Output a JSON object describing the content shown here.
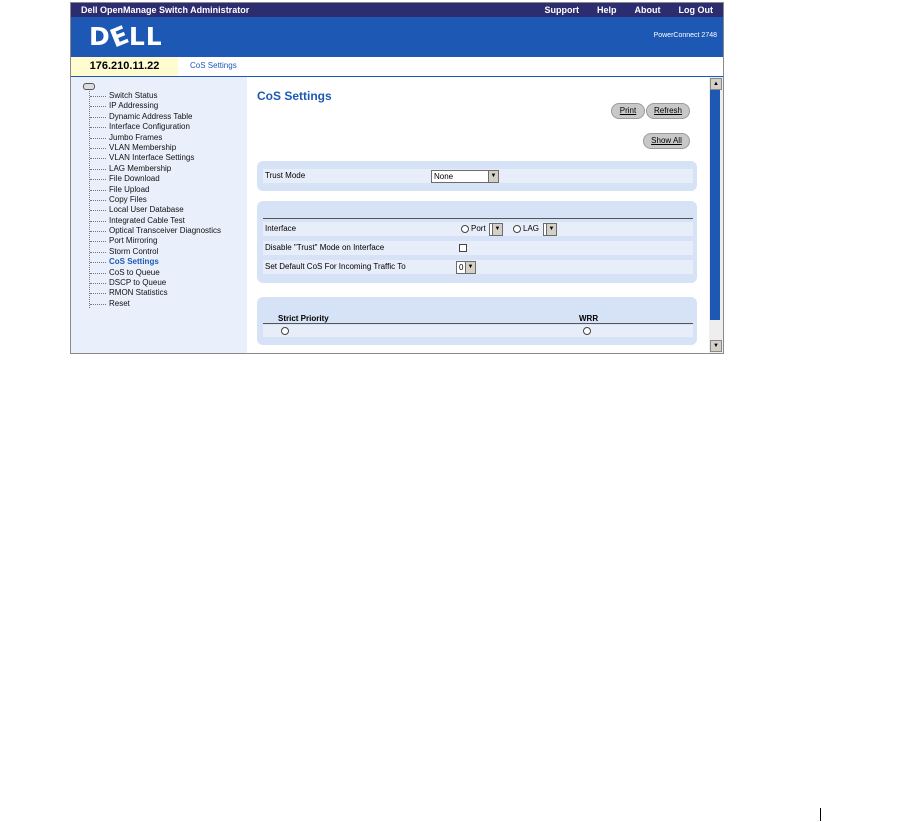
{
  "topbar": {
    "title": "Dell OpenManage Switch Administrator",
    "nav": [
      "Support",
      "Help",
      "About",
      "Log Out"
    ]
  },
  "brand": {
    "logo": "DELL",
    "model": "PowerConnect 2748"
  },
  "header": {
    "ip": "176.210.11.22",
    "breadcrumb": "CoS Settings"
  },
  "sidebar": {
    "items": [
      "Switch Status",
      "IP Addressing",
      "Dynamic Address Table",
      "Interface Configuration",
      "Jumbo Frames",
      "VLAN Membership",
      "VLAN Interface Settings",
      "LAG Membership",
      "File Download",
      "File Upload",
      "Copy Files",
      "Local User Database",
      "Integrated Cable Test",
      "Optical Transceiver Diagnostics",
      "Port Mirroring",
      "Storm Control",
      "CoS Settings",
      "CoS to Queue",
      "DSCP to Queue",
      "RMON Statistics",
      "Reset"
    ],
    "active": "CoS Settings"
  },
  "main": {
    "title": "CoS Settings",
    "print_label": "Print",
    "refresh_label": "Refresh",
    "show_all_label": "Show All",
    "trust_mode_label": "Trust Mode",
    "trust_mode_value": "None",
    "interface_label": "Interface",
    "port_label": "Port",
    "lag_label": "LAG",
    "disable_trust_label": "Disable \"Trust\" Mode on Interface",
    "default_cos_label": "Set Default CoS For Incoming Traffic To",
    "default_cos_value": "0",
    "strict_priority_label": "Strict Priority",
    "wrr_label": "WRR"
  },
  "colors": {
    "topbar": "#2c2c70",
    "brand": "#1d59b4",
    "panel": "#d6e2f5",
    "sidebar": "#eaf0fb"
  }
}
